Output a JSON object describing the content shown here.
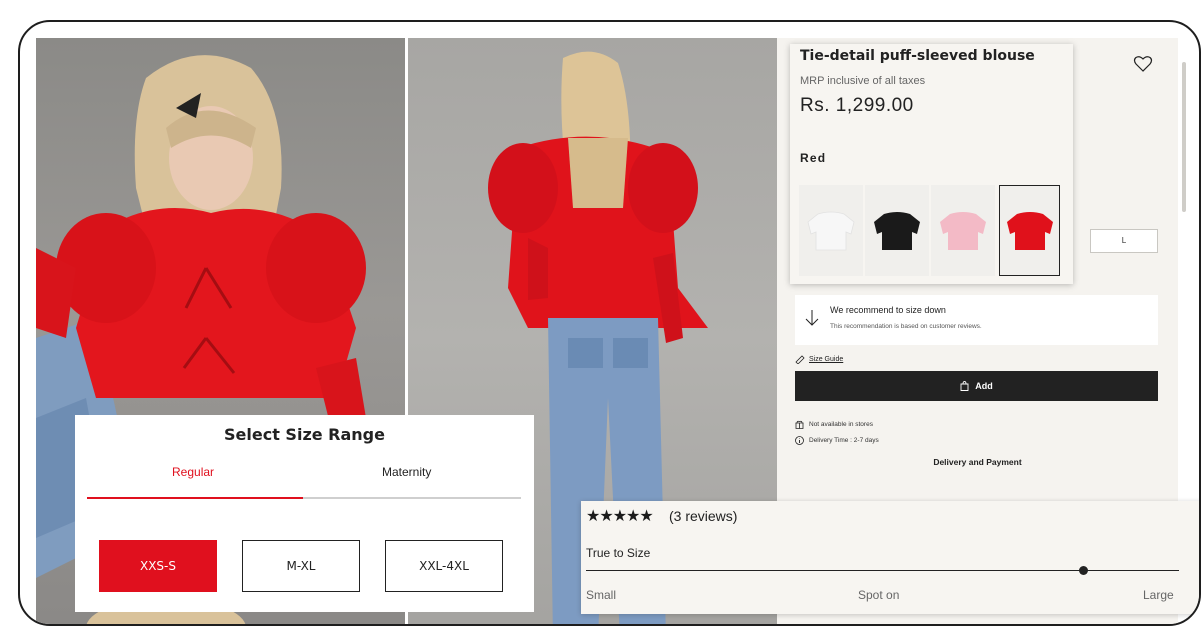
{
  "product": {
    "title": "Tie-detail puff-sleeved blouse",
    "mrp_note": "MRP inclusive of all taxes",
    "price": "Rs. 1,299.00",
    "selected_color": "Red",
    "colors": [
      {
        "name": "white",
        "hex": "#f4f4f4"
      },
      {
        "name": "black",
        "hex": "#1a1a1a"
      },
      {
        "name": "pink",
        "hex": "#f2b9c4"
      },
      {
        "name": "red",
        "hex": "#e0111b"
      }
    ]
  },
  "size_panel": {
    "partial_size_label": "L",
    "recommend_title": "We recommend to size down",
    "recommend_sub": "This recommendation is based on customer reviews.",
    "size_guide": "Size Guide",
    "add_button": "Add",
    "stock_note": "Not available in stores",
    "delivery_note": "Delivery Time : 2-7 days",
    "delivery_payment": "Delivery and Payment"
  },
  "size_range": {
    "heading": "Select Size Range",
    "tabs": [
      "Regular",
      "Maternity"
    ],
    "active_tab": "Regular",
    "options": [
      "XXS-S",
      "M-XL",
      "XXL-4XL"
    ],
    "selected_option": "XXS-S"
  },
  "reviews": {
    "stars": "★★★★★",
    "rating": 5,
    "count_text": "(3 reviews)",
    "fit_label": "True to Size",
    "fit_level": 0.84,
    "scale_labels": [
      "Small",
      "Spot on",
      "Large"
    ]
  },
  "colors": {
    "accent": "#e0101e",
    "button_dark": "#222222",
    "panel_bg": "#f5f3ef"
  }
}
